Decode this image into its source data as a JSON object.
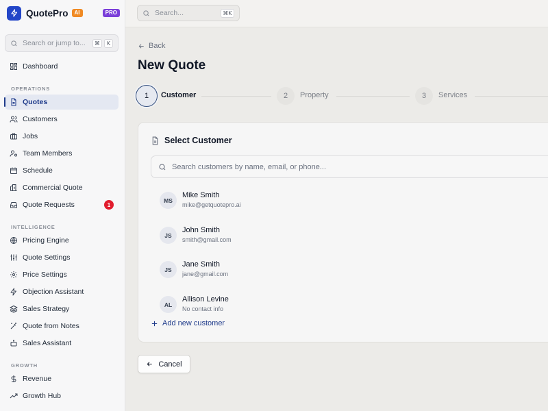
{
  "app": {
    "name": "QuotePro",
    "badge_ai": "AI",
    "badge_pro": "PRO"
  },
  "sidebar": {
    "search_placeholder": "Search or jump to...",
    "search_shortcut": [
      "⌘",
      "K"
    ],
    "top_item": {
      "label": "Dashboard",
      "icon": "dashboard-icon"
    },
    "sections": [
      {
        "label": "OPERATIONS",
        "items": [
          {
            "label": "Quotes",
            "icon": "file-text-icon",
            "active": true
          },
          {
            "label": "Customers",
            "icon": "users-icon"
          },
          {
            "label": "Jobs",
            "icon": "briefcase-icon"
          },
          {
            "label": "Team Members",
            "icon": "user-cog-icon"
          },
          {
            "label": "Schedule",
            "icon": "calendar-icon"
          },
          {
            "label": "Commercial Quote",
            "icon": "building-icon"
          },
          {
            "label": "Quote Requests",
            "icon": "inbox-icon",
            "count": "1"
          }
        ]
      },
      {
        "label": "INTELLIGENCE",
        "items": [
          {
            "label": "Pricing Engine",
            "icon": "globe-icon"
          },
          {
            "label": "Quote Settings",
            "icon": "sliders-icon"
          },
          {
            "label": "Price Settings",
            "icon": "gear-icon"
          },
          {
            "label": "Objection Assistant",
            "icon": "lightning-icon"
          },
          {
            "label": "Sales Strategy",
            "icon": "layers-icon"
          },
          {
            "label": "Quote from Notes",
            "icon": "magic-wand-icon"
          },
          {
            "label": "Sales Assistant",
            "icon": "bot-icon"
          }
        ]
      },
      {
        "label": "GROWTH",
        "items": [
          {
            "label": "Revenue",
            "icon": "dollar-icon"
          },
          {
            "label": "Growth Hub",
            "icon": "trending-up-icon"
          }
        ]
      }
    ]
  },
  "topbar": {
    "search_placeholder": "Search...",
    "shortcut": "⌘K"
  },
  "page": {
    "back_label": "Back",
    "title": "New Quote",
    "steps": [
      {
        "number": "1",
        "label": "Customer",
        "state": "active"
      },
      {
        "number": "2",
        "label": "Property",
        "state": "inactive"
      },
      {
        "number": "3",
        "label": "Services",
        "state": "inactive"
      }
    ]
  },
  "customer_card": {
    "title": "Select Customer",
    "search_placeholder": "Search customers by name, email, or phone...",
    "customers": [
      {
        "initials": "MS",
        "name": "Mike Smith",
        "email": "mike@getquotepro.ai"
      },
      {
        "initials": "JS",
        "name": "John Smith",
        "email": "smith@gmail.com"
      },
      {
        "initials": "JS",
        "name": "Jane Smith",
        "email": "jane@gmail.com"
      },
      {
        "initials": "AL",
        "name": "Allison Levine",
        "email": "No contact info"
      }
    ],
    "add_label": "Add new customer"
  },
  "footer": {
    "cancel_label": "Cancel"
  },
  "colors": {
    "brand": "#2346c8",
    "active_nav_bg": "#e4e8f2",
    "active_nav_text": "#1e3a8a",
    "badge_ai": "#f08a24",
    "badge_pro": "#7b3fd9",
    "count_badge": "#e11d2e",
    "link": "#1e3a8a"
  }
}
